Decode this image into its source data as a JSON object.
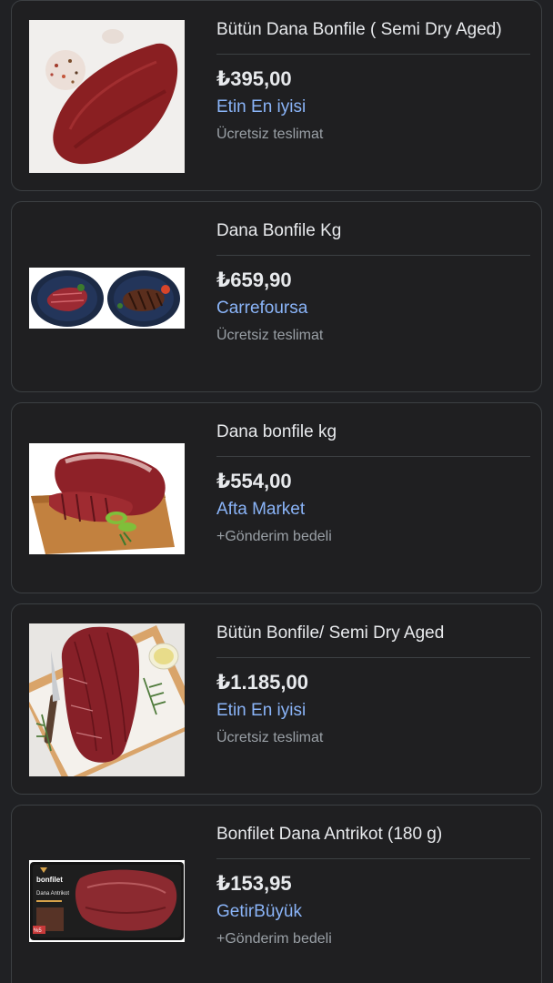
{
  "products": [
    {
      "title": "Bütün Dana Bonfile ( Semi Dry Aged)",
      "price": "₺395,00",
      "merchant": "Etin En iyisi",
      "shipping": "Ücretsiz teslimat",
      "image": "whole-beef-tenderloin-photo"
    },
    {
      "title": "Dana Bonfile Kg",
      "price": "₺659,90",
      "merchant": "Carrefoursa",
      "shipping": "Ücretsiz teslimat",
      "image": "sliced-steak-plates-photo"
    },
    {
      "title": "Dana bonfile kg",
      "price": "₺554,00",
      "merchant": "Afta Market",
      "shipping": "+Gönderim bedeli",
      "image": "tenderloin-on-board-photo"
    },
    {
      "title": "Bütün Bonfile/ Semi Dry Aged",
      "price": "₺1.185,00",
      "merchant": "Etin En iyisi",
      "shipping": "Ücretsiz teslimat",
      "image": "tenderloin-with-knife-photo"
    },
    {
      "title": "Bonfilet Dana Antrikot (180 g)",
      "price": "₺153,95",
      "merchant": "GetirBüyük",
      "shipping": "+Gönderim bedeli",
      "image": "packaged-steak-photo",
      "package_text": {
        "brand": "bonfilet",
        "line1": "Dana Antrikot",
        "badge": "%5"
      }
    }
  ],
  "colors": {
    "background": "#202124",
    "text": "#e8eaed",
    "link": "#8ab4f8",
    "muted": "#9aa0a6",
    "border": "#3c4043"
  }
}
